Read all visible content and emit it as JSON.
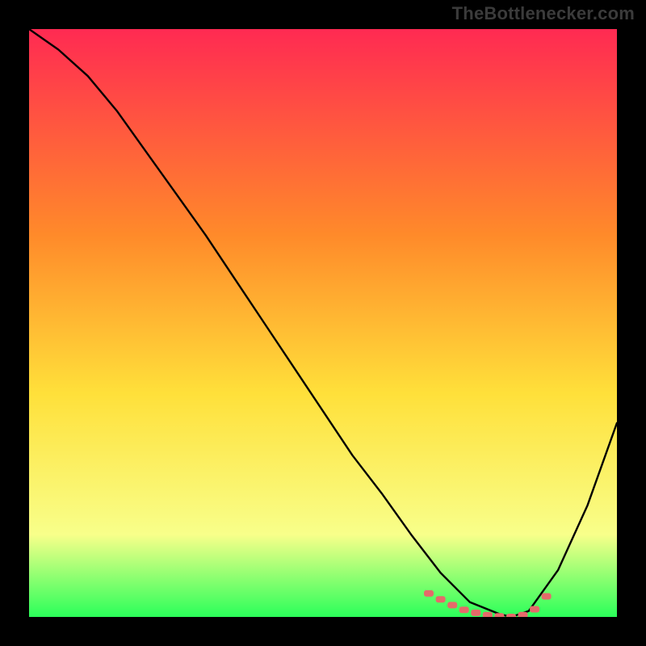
{
  "watermark": "TheBottlenecker.com",
  "colors": {
    "background": "#000000",
    "gradient_top": "#ff2a52",
    "gradient_mid1": "#ff8a2a",
    "gradient_mid2": "#ffe03a",
    "gradient_mid3": "#f8ff8a",
    "gradient_bottom": "#2bff5a",
    "curve": "#000000",
    "marker": "#e56a6a"
  },
  "chart_data": {
    "type": "line",
    "title": "",
    "xlabel": "",
    "ylabel": "",
    "x": [
      0.0,
      0.05,
      0.1,
      0.15,
      0.2,
      0.25,
      0.3,
      0.35,
      0.4,
      0.45,
      0.5,
      0.55,
      0.6,
      0.65,
      0.7,
      0.75,
      0.8,
      0.82,
      0.85,
      0.9,
      0.95,
      1.0
    ],
    "values": [
      1.0,
      0.965,
      0.92,
      0.86,
      0.79,
      0.72,
      0.65,
      0.575,
      0.5,
      0.425,
      0.35,
      0.275,
      0.21,
      0.14,
      0.075,
      0.025,
      0.005,
      0.0,
      0.01,
      0.08,
      0.19,
      0.33
    ],
    "ylim": [
      0,
      1
    ],
    "xlim": [
      0,
      1
    ],
    "marker_segment_x": [
      0.68,
      0.7,
      0.72,
      0.74,
      0.76,
      0.78,
      0.8,
      0.82,
      0.84,
      0.86,
      0.88
    ],
    "marker_segment_y": [
      0.04,
      0.03,
      0.02,
      0.012,
      0.007,
      0.003,
      0.001,
      0.0,
      0.003,
      0.013,
      0.035
    ]
  }
}
